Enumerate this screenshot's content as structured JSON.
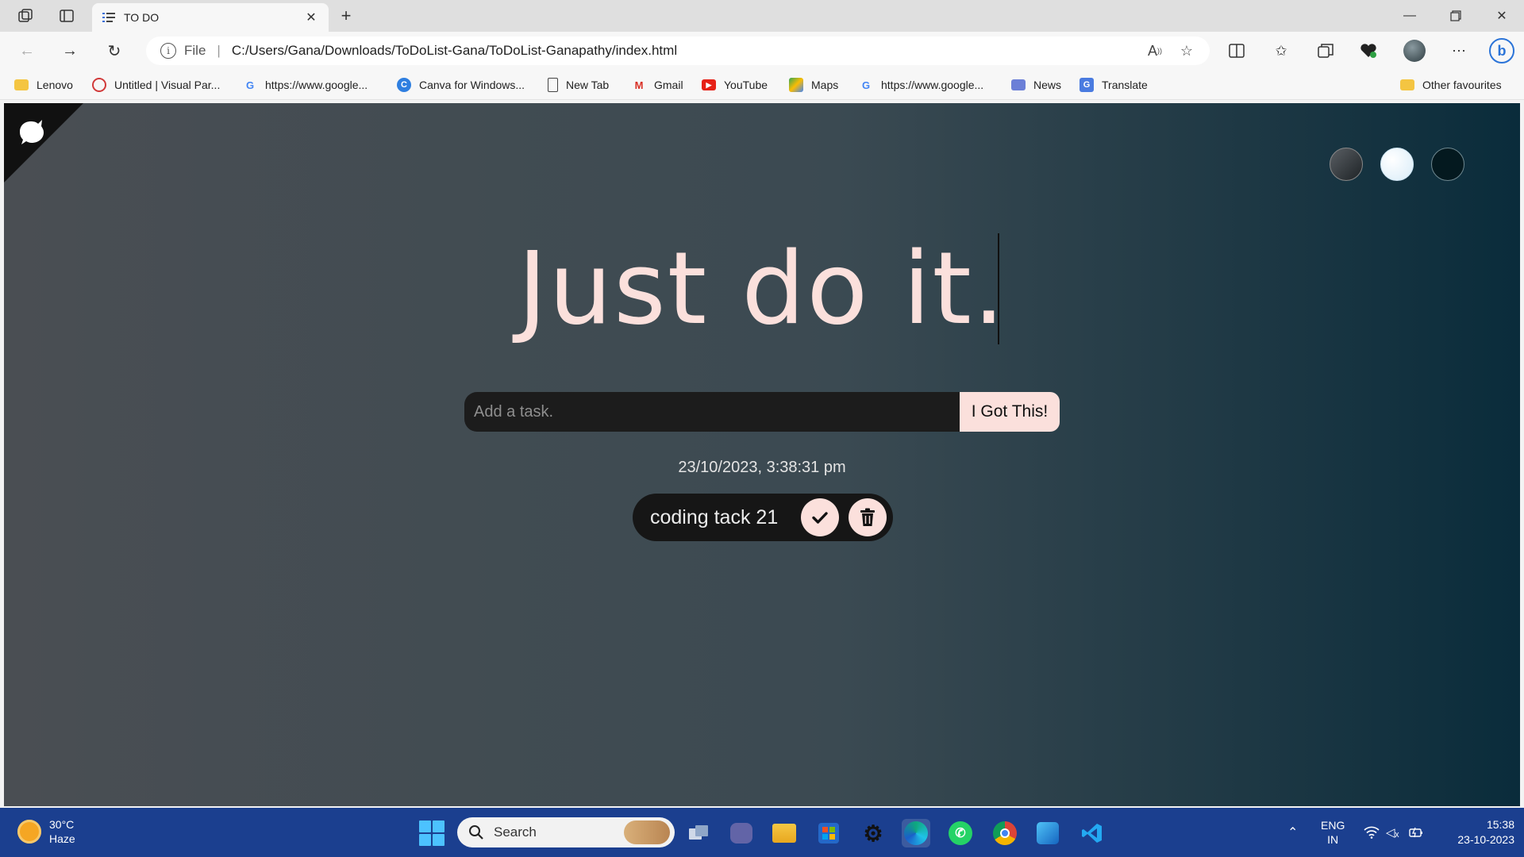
{
  "browser": {
    "tab_title": "TO DO",
    "address": {
      "scheme": "File",
      "url": "C:/Users/Gana/Downloads/ToDoList-Gana/ToDoList-Ganapathy/index.html"
    },
    "bookmarks": [
      {
        "label": "Lenovo",
        "icon": "folder-icon"
      },
      {
        "label": "Untitled | Visual Par...",
        "icon": "visual-paradigm-icon"
      },
      {
        "label": "https://www.google...",
        "icon": "google-icon"
      },
      {
        "label": "Canva for Windows...",
        "icon": "canva-icon"
      },
      {
        "label": "New Tab",
        "icon": "page-icon"
      },
      {
        "label": "Gmail",
        "icon": "gmail-icon"
      },
      {
        "label": "YouTube",
        "icon": "youtube-icon"
      },
      {
        "label": "Maps",
        "icon": "maps-icon"
      },
      {
        "label": "https://www.google...",
        "icon": "google-icon"
      },
      {
        "label": "News",
        "icon": "news-icon"
      },
      {
        "label": "Translate",
        "icon": "translate-icon"
      }
    ],
    "other_favourites": "Other favourites"
  },
  "app": {
    "heading": "Just do it.",
    "input_placeholder": "Add a task.",
    "input_value": "",
    "submit_label": "I Got This!",
    "datetime": "23/10/2023, 3:38:31 pm",
    "todos": [
      {
        "text": "coding tack 21"
      }
    ],
    "themes": [
      {
        "name": "standard",
        "color": "#3f4448"
      },
      {
        "name": "light",
        "color": "#eaf6ff"
      },
      {
        "name": "darker",
        "color": "#04191f"
      }
    ],
    "colors": {
      "accent": "#fbe0dc",
      "input_bg": "#1c1c1c"
    }
  },
  "taskbar": {
    "weather_temp": "30°C",
    "weather_desc": "Haze",
    "search_label": "Search",
    "language": "ENG",
    "region": "IN",
    "time": "15:38",
    "date": "23-10-2023"
  }
}
